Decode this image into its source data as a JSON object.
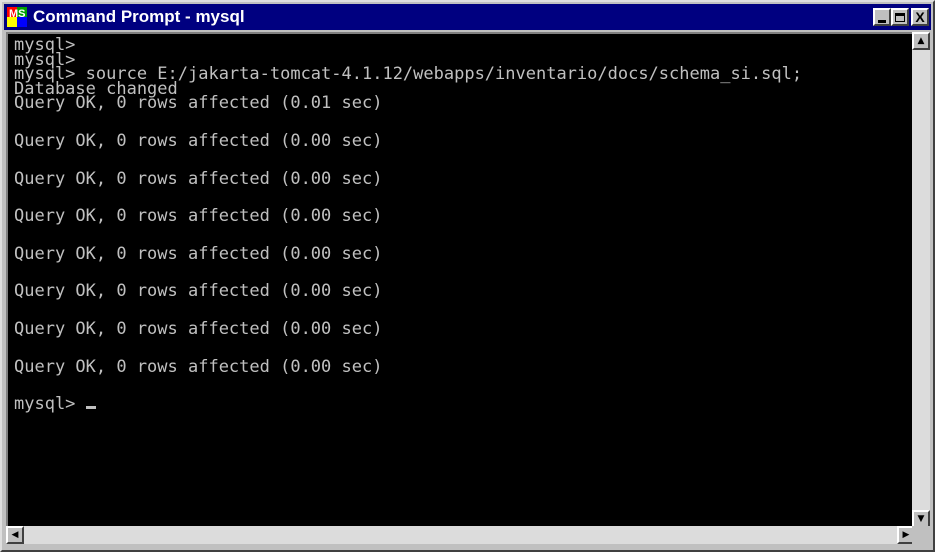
{
  "window": {
    "title": "Command Prompt - mysql",
    "app_icon": "ms-dos-icon",
    "icon_mark": "MS"
  },
  "title_buttons": {
    "minimize": "minimize-icon",
    "maximize": "maximize-icon",
    "close_label": "X"
  },
  "console": {
    "lines": [
      "mysql>",
      "mysql>",
      "mysql> source E:/jakarta-tomcat-4.1.12/webapps/inventario/docs/schema_si.sql;",
      "Database changed",
      "Query OK, 0 rows affected (0.01 sec)",
      "",
      "Query OK, 0 rows affected (0.00 sec)",
      "",
      "Query OK, 0 rows affected (0.00 sec)",
      "",
      "Query OK, 0 rows affected (0.00 sec)",
      "",
      "Query OK, 0 rows affected (0.00 sec)",
      "",
      "Query OK, 0 rows affected (0.00 sec)",
      "",
      "Query OK, 0 rows affected (0.00 sec)",
      "",
      "Query OK, 0 rows affected (0.00 sec)",
      "",
      "mysql> "
    ]
  },
  "scrollbars": {
    "up": "▲",
    "down": "▼",
    "left": "◀",
    "right": "▶"
  },
  "colors": {
    "titlebar": "#000080",
    "console_bg": "#000000",
    "console_text": "#c0c0c0"
  }
}
